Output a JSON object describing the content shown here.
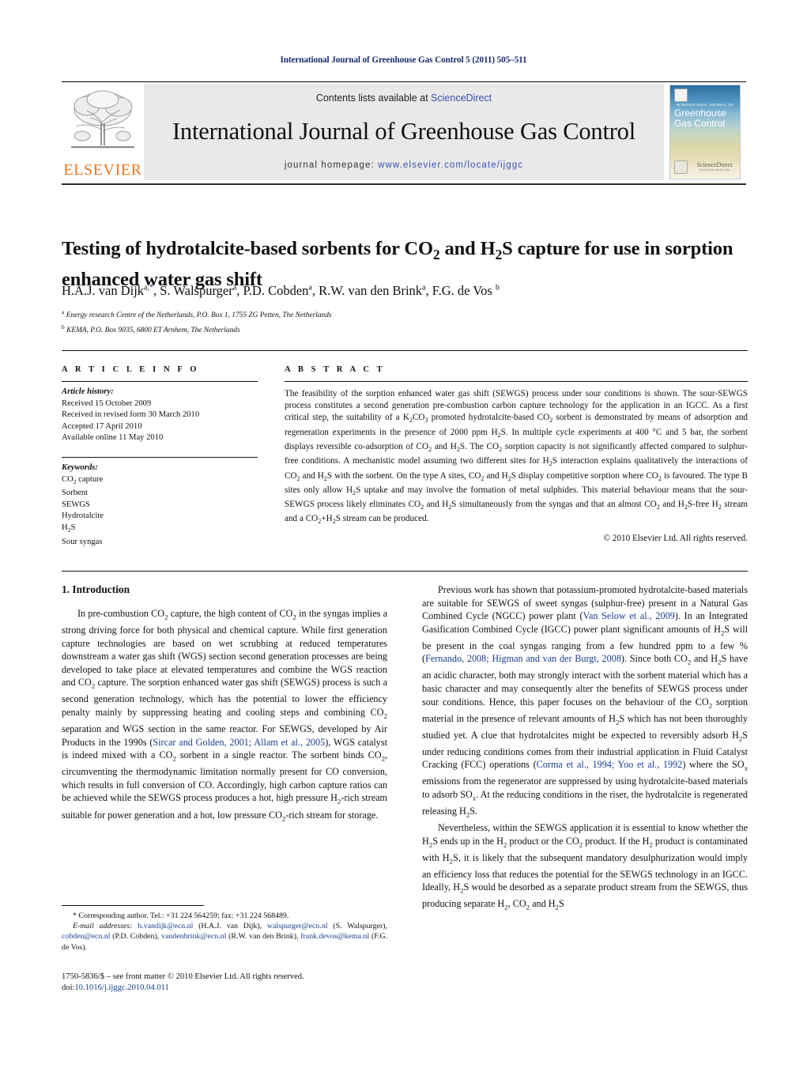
{
  "running_head": "International Journal of Greenhouse Gas Control 5 (2011) 505–511",
  "masthead": {
    "contents_prefix": "Contents lists available at ",
    "sciencedirect": "ScienceDirect",
    "journal_title": "International Journal of Greenhouse Gas Control",
    "homepage_prefix": "journal homepage: ",
    "homepage_url": "www.elsevier.com/locate/ijggc",
    "publisher_wordmark": "ELSEVIER",
    "cover": {
      "kicker": "INTERNATIONAL JOURNAL OF",
      "title_line1": "Greenhouse",
      "title_line2": "Gas Control",
      "footer_logo": "ScienceDirect",
      "footer_url": "www.sciencedirect.com"
    },
    "accent_orange": "#e87722",
    "link_blue": "#3b4fb0",
    "band_gray": "#e9e9e9"
  },
  "article": {
    "title_line1": "Testing of hydrotalcite-based sorbents for CO",
    "title_sub1": "2",
    "title_mid": " and H",
    "title_sub2": "2",
    "title_mid2": "S capture for use in",
    "title_line2": "sorption enhanced water gas shift",
    "authors_plain": "H.A.J. van Dijk a,*, S. Walspurger a, P.D. Cobden a, R.W. van den Brink a, F.G. de Vos b",
    "affiliation_a": "Energy research Centre of the Netherlands, P.O. Box 1, 1755 ZG Petten, The Netherlands",
    "affiliation_b": "KEMA, P.O. Box 9035, 6800 ET Arnhem, The Netherlands"
  },
  "info": {
    "heading": "A R T I C L E   I N F O",
    "history_label": "Article history:",
    "history": [
      "Received 15 October 2009",
      "Received in revised form 30 March 2010",
      "Accepted 17 April 2010",
      "Available online 11 May 2010"
    ],
    "keywords_label": "Keywords:",
    "keywords": [
      "CO2 capture",
      "Sorbent",
      "SEWGS",
      "Hydrotalcite",
      "H2S",
      "Sour syngas"
    ]
  },
  "abstract": {
    "heading": "A B S T R A C T",
    "copyright": "© 2010 Elsevier Ltd. All rights reserved."
  },
  "sections": {
    "introduction_heading": "1. Introduction"
  },
  "footnotes": {
    "corresponding": "* Corresponding author. Tel.: +31 224 564259; fax: +31 224 568489.",
    "email_label": "E-mail addresses:",
    "emails": [
      {
        "address": "h.vandijk@ecn.nl",
        "person": "(H.A.J. van Dijk)"
      },
      {
        "address": "walspurger@ecn.nl",
        "person": "(S. Walspurger)"
      },
      {
        "address": "cobden@ecn.nl",
        "person": "(P.D. Cobden)"
      },
      {
        "address": "vandenbrink@ecn.nl",
        "person": "(R.W. van den Brink)"
      },
      {
        "address": "frank.devos@kema.nl",
        "person": "(F.G. de Vos)"
      }
    ],
    "frontmatter": "1750-5836/$ – see front matter © 2010 Elsevier Ltd. All rights reserved.",
    "doi_label": "doi:",
    "doi": "10.1016/j.ijggc.2010.04.011"
  }
}
